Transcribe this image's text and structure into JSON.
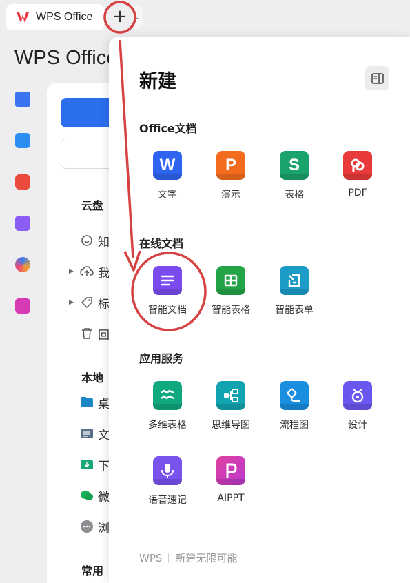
{
  "tab": {
    "title": "WPS Office",
    "plus_label": "+",
    "more_label": "⌄"
  },
  "app": {
    "title": "WPS Office"
  },
  "sidebar": {
    "cloud_label": "云盘",
    "cloud_items": [
      {
        "icon": "smile-icon",
        "label": "知"
      },
      {
        "icon": "cloud-upload-icon",
        "label": "我"
      },
      {
        "icon": "tag-icon",
        "label": "标"
      },
      {
        "icon": "trash-icon",
        "label": "回"
      }
    ],
    "local_label": "本地",
    "local_items": [
      {
        "icon": "desktop-folder-icon",
        "label": "桌"
      },
      {
        "icon": "documents-folder-icon",
        "label": "文"
      },
      {
        "icon": "download-folder-icon",
        "label": "下"
      },
      {
        "icon": "wechat-icon",
        "label": "微"
      },
      {
        "icon": "more-icon",
        "label": "浏"
      }
    ],
    "common_label": "常用"
  },
  "popup": {
    "title": "新建",
    "office_section": "Office文档",
    "office_items": [
      {
        "label": "文字",
        "glyph": "W",
        "color": "#2f64f0"
      },
      {
        "label": "演示",
        "glyph": "P",
        "color": "#f36b1c"
      },
      {
        "label": "表格",
        "glyph": "S",
        "color": "#1aa36a"
      },
      {
        "label": "PDF",
        "glyph": "",
        "color": "#e83a3a"
      }
    ],
    "online_section": "在线文档",
    "online_items": [
      {
        "label": "智能文档",
        "color": "#7a4cf0"
      },
      {
        "label": "智能表格",
        "color": "#22a447"
      },
      {
        "label": "智能表单",
        "color": "#1b9bc6"
      }
    ],
    "apps_section": "应用服务",
    "app_items": [
      {
        "label": "多维表格",
        "color": "#10a87f"
      },
      {
        "label": "思维导图",
        "color": "#11a3b0"
      },
      {
        "label": "流程图",
        "color": "#1a8fe0"
      },
      {
        "label": "设计",
        "color": "#6a57f0"
      },
      {
        "label": "语音速记",
        "color": "#7a52ee"
      },
      {
        "label": "AIPPT",
        "color": "#d63bb3"
      }
    ],
    "footer_brand": "WPS",
    "footer_slogan": "新建无限可能"
  },
  "annotation_color": "#d64242"
}
